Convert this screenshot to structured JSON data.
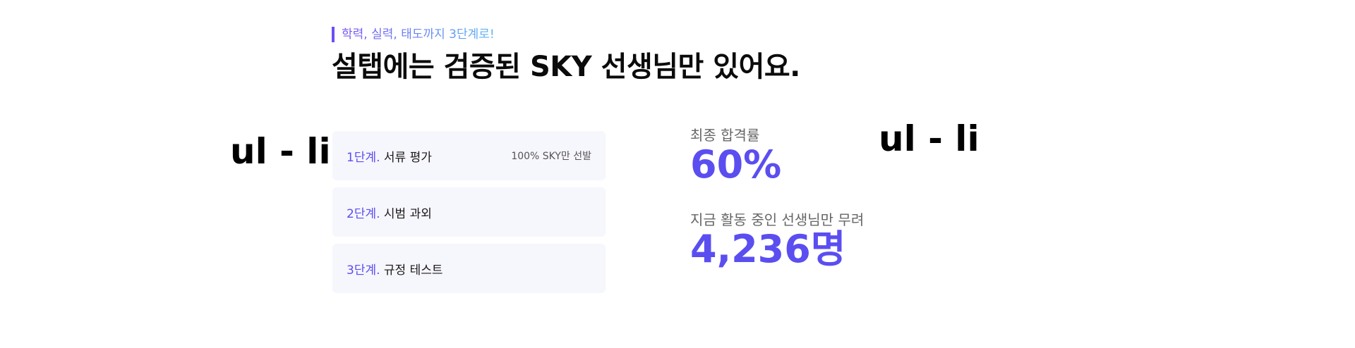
{
  "section": {
    "eyebrow": "학력, 실력, 태도까지 3단계로!",
    "headline": "설탭에는 검증된 SKY 선생님만 있어요."
  },
  "annotations": {
    "left": "ul - li",
    "right": "ul - li"
  },
  "steps": [
    {
      "number": "1단계.",
      "title": "서류 평가",
      "note": "100% SKY만 선발"
    },
    {
      "number": "2단계.",
      "title": "시범 과외",
      "note": ""
    },
    {
      "number": "3단계.",
      "title": "규정 테스트",
      "note": ""
    }
  ],
  "stats": [
    {
      "label": "최종 합격률",
      "value": "60%"
    },
    {
      "label": "지금 활동 중인 선생님만 무려",
      "value": "4,236명"
    }
  ],
  "colors": {
    "accent": "#5b4ef0",
    "eyebrow_gradient_start": "#7a4ff0",
    "eyebrow_gradient_end": "#5bb6f5",
    "step_background": "#f6f6fd",
    "label_gray": "#666666"
  }
}
